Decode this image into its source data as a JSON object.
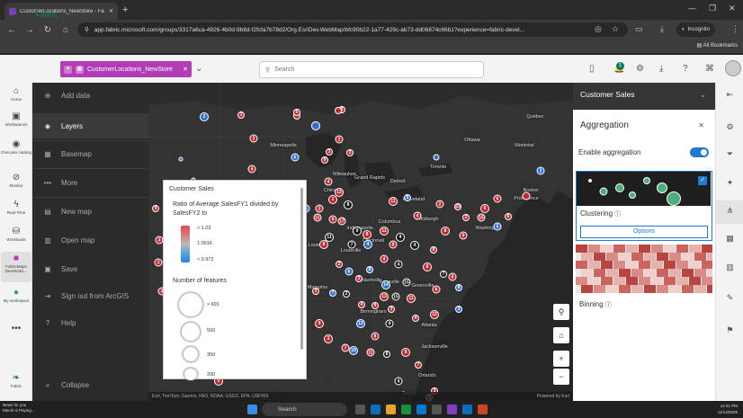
{
  "browser": {
    "tab_title": "CustomerLocations_NewStore - Fa",
    "url": "app.fabric.microsoft.com/groups/3317a6ca-4926-4b0d-9b8d-f2fcfa7b78d2/Org.EsriDev.WebMap/bfc90b22-1a77-429c-ab73-dd06874c66b1?experience=fabric-devel...",
    "incognito_label": "Incognito",
    "all_bookmarks": "All Bookmarks"
  },
  "fabric": {
    "brand": "Fabric",
    "workspace_item": "CustomerLocations_NewStore",
    "search_placeholder": "Search",
    "notification_count": "1"
  },
  "rail": [
    {
      "label": "Home",
      "icon": "home-icon"
    },
    {
      "label": "Workspaces",
      "icon": "workspaces-icon"
    },
    {
      "label": "OneLake catalog",
      "icon": "onelake-icon"
    },
    {
      "label": "Monitor",
      "icon": "monitor-icon"
    },
    {
      "label": "Real-Time",
      "icon": "realtime-icon"
    },
    {
      "label": "Workloads",
      "icon": "workloads-icon"
    },
    {
      "label": "FabricMaps DevWorks...",
      "icon": "fabricmaps-icon"
    },
    {
      "label": "My workspace",
      "icon": "my-workspace-icon"
    },
    {
      "label": "Fabric",
      "icon": "fabric-logo-icon"
    }
  ],
  "esri_nav": {
    "items": [
      "Add data",
      "Layers",
      "Basemap",
      "More",
      "New map",
      "Open map",
      "Save",
      "Sign out from ArcGIS",
      "Help"
    ],
    "active": "Layers",
    "collapse": "Collapse"
  },
  "map": {
    "attribution": "Esri, TomTom, Garmin, FAO, NOAA, USGS, EPA, USFWS",
    "powered_by": "Powered by Esri",
    "cities": [
      "Minneapolis",
      "Milwaukee",
      "Grand Rapids",
      "Detroit",
      "Toronto",
      "Ottawa",
      "Montréal",
      "Québec",
      "Boston",
      "Providence",
      "Chicago",
      "Cleveland",
      "Pittsburgh",
      "Indianapolis",
      "Columbus",
      "Cincinnati",
      "Washington",
      "St. Louis",
      "Louisville",
      "Nashville",
      "Knoxville",
      "Greenville",
      "Memphis",
      "Atlanta",
      "Birmingham",
      "Jacksonville",
      "Orlando",
      "Tampa"
    ]
  },
  "legend": {
    "layer_title": "Customer Sales",
    "ratio_label": "Ratio of Average SalesFY1 divided by SalesFY2 to",
    "ramp_labels": [
      "> 1.03",
      "1.0016",
      "< 0.972"
    ],
    "count_label": "Number of features",
    "size_labels": [
      "> 691",
      "500",
      "350",
      "200"
    ]
  },
  "panel": {
    "layer_name": "Customer Sales",
    "title": "Aggregation",
    "enable_label": "Enable aggregation",
    "enabled": true,
    "clustering_label": "Clustering",
    "options_label": "Options",
    "binning_label": "Binning"
  },
  "taskbar": {
    "news_title": "News for you",
    "news_sub": "Merck is Paying...",
    "search_placeholder": "Search",
    "time": "12:41 PM",
    "date": "11/14/2025"
  },
  "colors": {
    "red_cluster": "#c0282f",
    "blue_cluster": "#2f6fd1",
    "dark_cluster": "#1a1a1a",
    "fabric_accent": "#117865",
    "workspace_chip": "#b23bb6",
    "toggle_on": "#1e7ad4"
  }
}
